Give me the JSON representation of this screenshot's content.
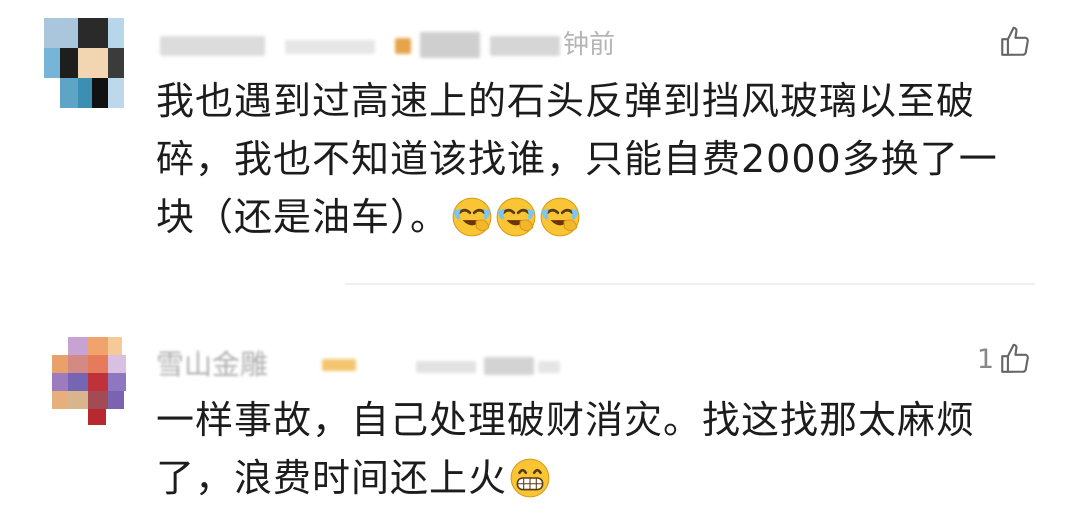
{
  "comments": [
    {
      "username": "",
      "time_suffix": "钟前",
      "like_count": "",
      "text_lines": [
        "我也遇到过高速上的石头反弹到挡风玻璃以至破",
        "碎，我也不知道该找谁，只能自费2000多换了一",
        "块（还是油车）。"
      ],
      "emojis": [
        "crying-laughing",
        "crying-laughing",
        "crying-laughing"
      ]
    },
    {
      "username": "雪山金雕",
      "time_suffix": "",
      "like_count": "1",
      "text_lines": [
        "一样事故，自己处理破财消灾。找这找那太麻烦",
        "了，浪费时间还上火"
      ],
      "emojis": [
        "grinning-teeth"
      ]
    }
  ],
  "colors": {
    "text": "#1c1c1c",
    "meta": "#b5b5b5",
    "emoji_face": "#f9c534",
    "divider": "#f0f0f0"
  }
}
